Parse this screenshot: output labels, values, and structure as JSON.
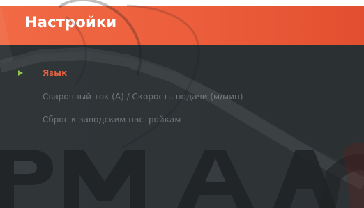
{
  "screen": {
    "title": "Настройки"
  },
  "menu": {
    "items": [
      {
        "label": "Язык",
        "selected": true
      },
      {
        "label": "Сварочный ток (А) / Скорость подачи (м/мин)",
        "selected": false
      },
      {
        "label": "Сброс к заводским настройкам",
        "selected": false
      }
    ]
  },
  "icons": {
    "selection_marker": "play-triangle",
    "background_art": "brand-watermark"
  },
  "colors": {
    "header_start": "#f06a45",
    "header_end": "#e24f30",
    "screen_bg": "#2b3033",
    "selected_text": "#e45d3d",
    "normal_text": "#6d7276",
    "marker": "#8bc34a",
    "watermark_dark": "#1f2224",
    "watermark_light": "#f2f2f2"
  }
}
